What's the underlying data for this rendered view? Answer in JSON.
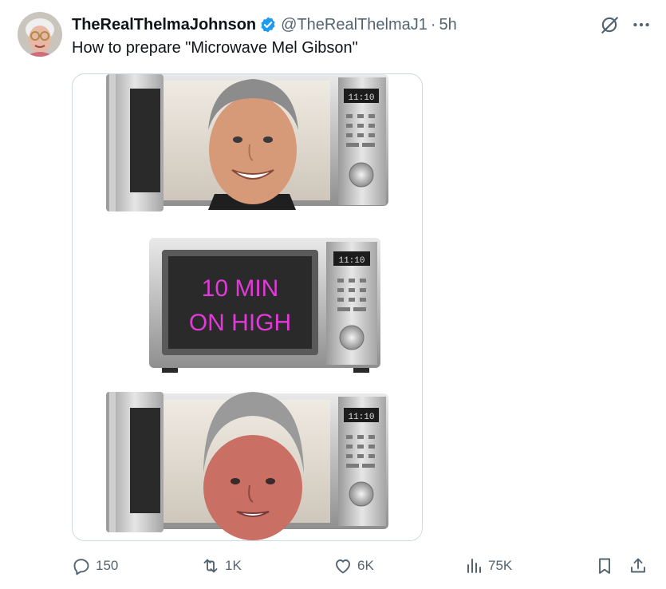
{
  "tweet": {
    "author": {
      "display_name": "TheRealThelmaJohnson",
      "handle": "@TheRealThelmaJ1",
      "verified_icon": "verified-badge-icon",
      "avatar_icon": "avatar"
    },
    "separator": "·",
    "time": "5h",
    "text": "How to prepare \"Microwave Mel Gibson\"",
    "media": {
      "panel_1_clock": "11:10",
      "panel_2_clock": "11:10",
      "panel_2_line_1": "10 MIN",
      "panel_2_line_2": "ON HIGH",
      "panel_3_clock": "11:10"
    },
    "actions": {
      "replies": "150",
      "reposts": "1K",
      "likes": "6K",
      "views": "75K"
    },
    "icons": {
      "grok": "grok-icon",
      "more": "more-icon",
      "reply": "reply-icon",
      "repost": "repost-icon",
      "like": "heart-icon",
      "views": "views-icon",
      "bookmark": "bookmark-icon",
      "share": "share-icon"
    },
    "colors": {
      "text_primary": "#0f1419",
      "text_secondary": "#536471",
      "verified": "#1d9bf0",
      "oven_text": "#e23ad8",
      "border": "#cfd9de"
    }
  }
}
